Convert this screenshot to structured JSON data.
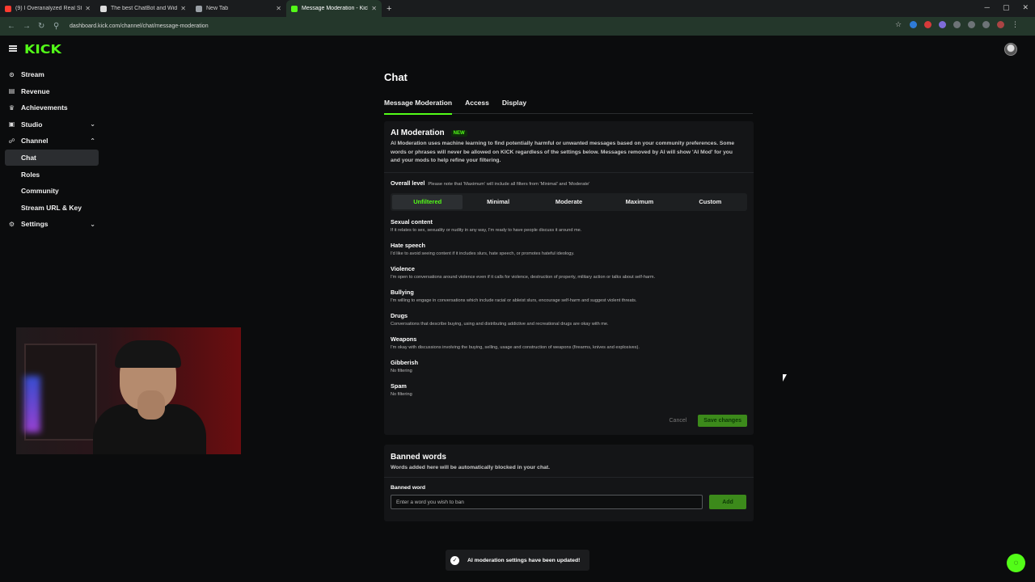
{
  "browser": {
    "tabs": [
      {
        "label": "(9) I Overanalyzed Real Steel A",
        "color": "#ff3b30",
        "active": false
      },
      {
        "label": "The best ChatBot and Widgets",
        "color": "#dddddd",
        "active": false
      },
      {
        "label": "New Tab",
        "color": "#9aa0a6",
        "active": false
      },
      {
        "label": "Message Moderation - Kick Da",
        "color": "#53fc18",
        "active": true
      }
    ],
    "url": "dashboard.kick.com/channel/chat/message-moderation"
  },
  "brand": {
    "logo": "KICK",
    "accent": "#53fc18"
  },
  "sidebar": {
    "items": [
      {
        "label": "Stream",
        "icon": "stream-icon",
        "glyph": "⊙",
        "chev": "",
        "sub": false,
        "active": false
      },
      {
        "label": "Revenue",
        "icon": "revenue-icon",
        "glyph": "▤",
        "chev": "",
        "sub": false,
        "active": false
      },
      {
        "label": "Achievements",
        "icon": "trophy-icon",
        "glyph": "♛",
        "chev": "",
        "sub": false,
        "active": false
      },
      {
        "label": "Studio",
        "icon": "studio-icon",
        "glyph": "▣",
        "chev": "⌄",
        "sub": false,
        "active": false
      },
      {
        "label": "Channel",
        "icon": "channel-icon",
        "glyph": "☍",
        "chev": "⌃",
        "sub": false,
        "active": false
      },
      {
        "label": "Chat",
        "icon": "",
        "glyph": "",
        "chev": "",
        "sub": true,
        "active": true
      },
      {
        "label": "Roles",
        "icon": "",
        "glyph": "",
        "chev": "",
        "sub": true,
        "active": false
      },
      {
        "label": "Community",
        "icon": "",
        "glyph": "",
        "chev": "",
        "sub": true,
        "active": false
      },
      {
        "label": "Stream URL & Key",
        "icon": "",
        "glyph": "",
        "chev": "",
        "sub": true,
        "active": false
      },
      {
        "label": "Settings",
        "icon": "gear-icon",
        "glyph": "⚙",
        "chev": "⌄",
        "sub": false,
        "active": false
      }
    ]
  },
  "page": {
    "title": "Chat",
    "tabs": [
      "Message Moderation",
      "Access",
      "Display"
    ]
  },
  "ai": {
    "title": "AI Moderation",
    "badge": "NEW",
    "description": "AI Moderation uses machine learning to find potentially harmful or unwanted messages based on your community preferences. Some words or phrases will never be allowed on KICK regardless of the settings below. Messages removed by AI will show 'AI Mod' for you and your mods to help refine your filtering.",
    "overall_title": "Overall level",
    "overall_note": "Please note that 'Maximum' will include all filters from 'Minimal' and 'Moderate'",
    "levels": [
      "Unfiltered",
      "Minimal",
      "Moderate",
      "Maximum",
      "Custom"
    ],
    "selected_level": "Unfiltered",
    "categories": [
      {
        "name": "Sexual content",
        "desc": "If it relates to sex, sexuality or nudity in any way, I'm ready to have people discuss it around me."
      },
      {
        "name": "Hate speech",
        "desc": "I'd like to avoid seeing content if it includes slurs, hate speech, or promotes hateful ideology."
      },
      {
        "name": "Violence",
        "desc": "I'm open to conversations around violence even if it calls for violence, destruction of property, military action or talks about self-harm."
      },
      {
        "name": "Bullying",
        "desc": "I'm willing to engage in conversations which include racial or ableist slurs, encourage self-harm and suggest violent threats."
      },
      {
        "name": "Drugs",
        "desc": "Conversations that describe buying, using and distributing addictive and recreational drugs are okay with me."
      },
      {
        "name": "Weapons",
        "desc": "I'm okay with discussions involving the buying, selling, usage and construction of weapons (firearms, knives and explosives)."
      },
      {
        "name": "Gibberish",
        "desc": "No filtering"
      },
      {
        "name": "Spam",
        "desc": "No filtering"
      }
    ],
    "cancel_label": "Cancel",
    "save_label": "Save changes"
  },
  "banned": {
    "title": "Banned words",
    "description": "Words added here will be automatically blocked in your chat.",
    "field_label": "Banned word",
    "placeholder": "Enter a word you wish to ban",
    "value": "",
    "add_label": "Add"
  },
  "toast": {
    "message": "AI moderation settings have been updated!"
  }
}
